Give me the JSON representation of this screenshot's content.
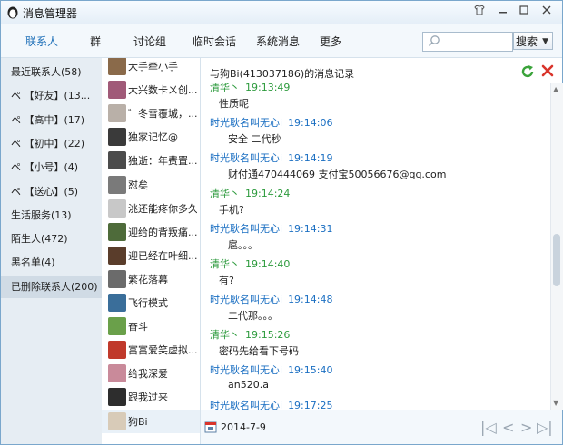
{
  "window": {
    "title": "消息管理器",
    "skin_icon": "shirt-icon",
    "min_icon": "minimize-icon",
    "max_icon": "maximize-icon",
    "close_icon": "close-icon"
  },
  "nav": {
    "tabs": [
      "联系人",
      "群",
      "讨论组",
      "临时会话",
      "系统消息",
      "更多"
    ],
    "active_tab": "联系人",
    "search_placeholder": "",
    "search_button": "搜索"
  },
  "categories": [
    {
      "label": "最近联系人(58)"
    },
    {
      "label": "ペ    【好友】(13..."
    },
    {
      "label": "ペ    【高中】(17)"
    },
    {
      "label": "ペ    【初中】(22)"
    },
    {
      "label": "ペ    【小号】(4)"
    },
    {
      "label": "ペ    【送心】(5)"
    },
    {
      "label": "生活服务(13)"
    },
    {
      "label": "陌生人(472)"
    },
    {
      "label": "黑名单(4)"
    },
    {
      "label": "已删除联系人(200)"
    }
  ],
  "active_category_index": 9,
  "contacts": [
    {
      "name": "大手牵小手",
      "color": "#8a6a4a"
    },
    {
      "name": "大兴数卡ㄨ创...",
      "color": "#a05a78"
    },
    {
      "name": "゛冬雪覆城，...",
      "color": "#b9b0a8"
    },
    {
      "name": "独家记忆@",
      "color": "#3a3a3a"
    },
    {
      "name": "独逝：年费置...",
      "color": "#4b4b4b"
    },
    {
      "name": "怼矣",
      "color": "#7a7a7a"
    },
    {
      "name": "洮还能疼你多久",
      "color": "#c8c8c8"
    },
    {
      "name": "迎给的背叛痛...",
      "color": "#4e6b3a"
    },
    {
      "name": "迎已经在叶细...",
      "color": "#5a3d2b"
    },
    {
      "name": "繁花落幕",
      "color": "#6b6b6b"
    },
    {
      "name": "飞行模式",
      "color": "#3a6e9a"
    },
    {
      "name": "奋斗",
      "color": "#6aa04a"
    },
    {
      "name": "富富爱笑虚拟...",
      "color": "#c0392b"
    },
    {
      "name": "给我深爱",
      "color": "#c98a9a"
    },
    {
      "name": "跟我过来",
      "color": "#2d2d2d"
    },
    {
      "name": "狗Bi",
      "color": "#d8cbb8"
    }
  ],
  "selected_contact_index": 15,
  "history": {
    "title": "与狗Bi(413037186)的消息记录",
    "refresh_icon": "refresh-icon",
    "close_icon": "close-x-icon"
  },
  "messages": [
    {
      "sender": "清华丶",
      "time": "19:13:49",
      "text": "性质呢",
      "who": "g"
    },
    {
      "sender": "时光耿名叫无心i",
      "time": "19:14:06",
      "text": "安全 二代秒",
      "who": "b"
    },
    {
      "sender": "时光耿名叫无心i",
      "time": "19:14:19",
      "text": "财付通470444069  支付宝50056676@qq.com",
      "who": "b"
    },
    {
      "sender": "清华丶",
      "time": "19:14:24",
      "text": "手机?",
      "who": "g"
    },
    {
      "sender": "时光耿名叫无心i",
      "time": "19:14:31",
      "text": "扈。。。",
      "who": "b"
    },
    {
      "sender": "清华丶",
      "time": "19:14:40",
      "text": "有?",
      "who": "g"
    },
    {
      "sender": "时光耿名叫无心i",
      "time": "19:14:48",
      "text": "二代那。。。",
      "who": "b"
    },
    {
      "sender": "清华丶",
      "time": "19:15:26",
      "text": "密码先给看下号码",
      "who": "g"
    },
    {
      "sender": "时光耿名叫无心i",
      "time": "19:15:40",
      "text": "an520.a",
      "who": "b"
    },
    {
      "sender": "时光耿名叫无心i",
      "time": "19:17:25",
      "text": "",
      "who": "b"
    }
  ],
  "footer": {
    "date": "2014-7-9",
    "calendar_icon": "calendar-icon",
    "first_icon": "first-page-icon",
    "prev_icon": "prev-page-icon",
    "next_icon": "next-page-icon",
    "last_icon": "last-page-icon"
  },
  "colors": {
    "accent": "#1d6fb8",
    "sender_self": "#1b6fc2",
    "sender_other": "#2c9a3c",
    "close_red": "#d9342b",
    "refresh_green": "#3aa33a"
  }
}
